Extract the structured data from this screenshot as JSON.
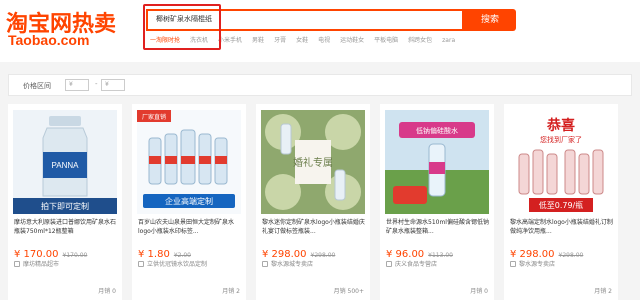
{
  "logo": {
    "main": "淘宝网热卖",
    "sub": "Taobao.com"
  },
  "search": {
    "query": "椰树矿泉水隔棍纸",
    "button": "搜索"
  },
  "hotwords": [
    "一淘限时抢",
    "洗衣机",
    "小米手机",
    "男鞋",
    "牙膏",
    "女鞋",
    "电视",
    "运动鞋女",
    "平板电脑",
    "斜跨女包",
    "zara"
  ],
  "filter": {
    "label": "价格区间",
    "min_placeholder": "¥",
    "max_placeholder": "¥",
    "dash": "-"
  },
  "colors": {
    "brand": "#ff4400",
    "highlight": "#e0201f"
  },
  "products": [
    {
      "title": "摩坊意大利原装进口普娜饮用矿泉水石瓶装750ml*12瓶整箱",
      "price": "¥ 170.00",
      "old_price": "¥170.00",
      "shop": "摩坊精品超市",
      "sales": "月销 0",
      "image_caption": "拍下即可定制",
      "image_icon": "bottle-water-icon"
    },
    {
      "title": "百岁山农夫山泉景田恒大定制矿泉水logo小瓶装水印标签...",
      "price": "¥ 1.80",
      "old_price": "¥2.00",
      "shop": "立供优冠镜水饮品定制",
      "sales": "月销 2",
      "image_caption": "企业高端定制",
      "image_badge": "厂家直销",
      "image_icon": "bottle-water-icon"
    },
    {
      "title": "黎水迷你定制矿泉水logo小瓶装结婚庆礼宴订做标签瓶装...",
      "price": "¥ 298.00",
      "old_price": "¥298.00",
      "shop": "黎水源城专卖店",
      "sales": "月销 500+",
      "image_caption": "婚礼专属",
      "image_icon": "wedding-icon"
    },
    {
      "title": "世界村生命源水510ml偏硅酸含锶低钠矿泉水瓶装整箱...",
      "price": "¥ 96.00",
      "old_price": "¥113.00",
      "shop": "庆义食品专营店",
      "sales": "月销 0",
      "image_caption": "低钠偏硅酸水",
      "image_icon": "bottle-water-icon"
    },
    {
      "title": "黎水高端定制水logo小瓶装结婚礼订制做纯净饮用瓶...",
      "price": "¥ 298.00",
      "old_price": "¥298.00",
      "shop": "黎水源专卖店",
      "sales": "月销 2",
      "image_caption": "低至0.79/瓶",
      "image_top": "恭喜",
      "image_sub": "您找到厂家了",
      "image_icon": "bottle-water-icon"
    }
  ]
}
